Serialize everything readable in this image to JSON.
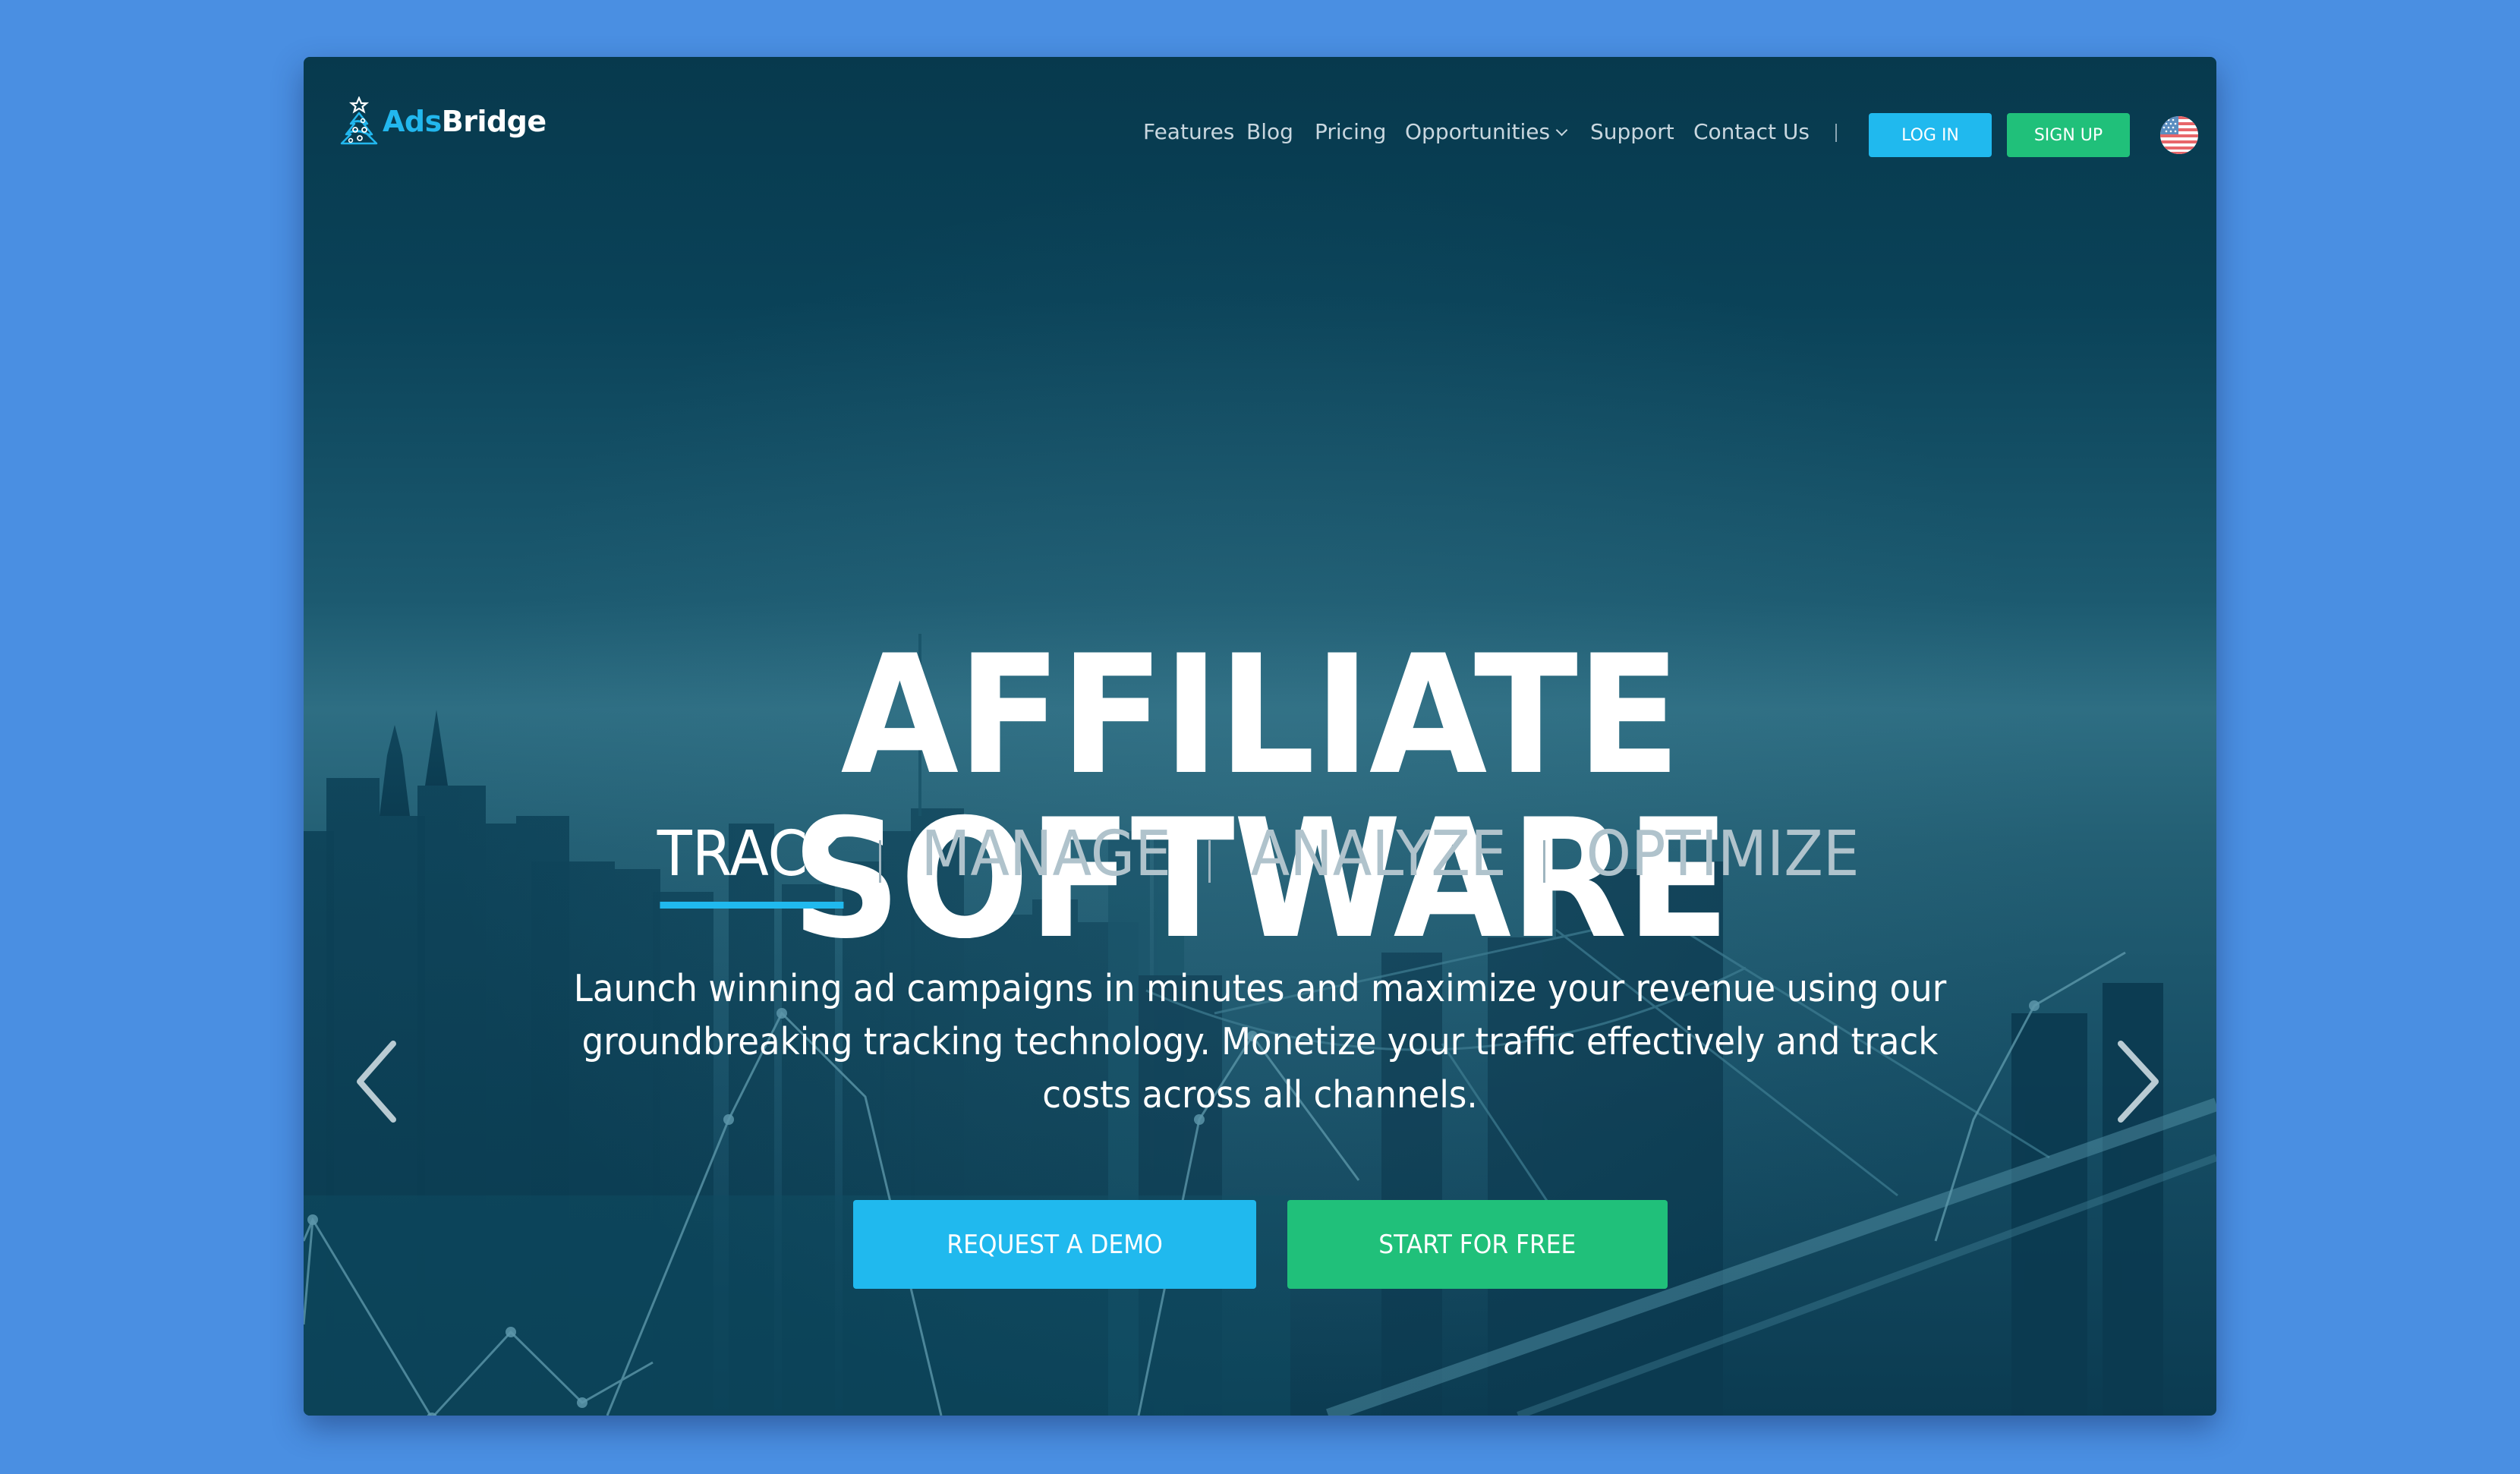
{
  "brand": {
    "name_part1": "Ads",
    "name_part2": "Bridge",
    "logo_icon": "christmas-tree-icon",
    "accent_color": "#20b9ee",
    "success_color": "#20c07a"
  },
  "nav": {
    "items": [
      {
        "label": "Features"
      },
      {
        "label": "Blog"
      },
      {
        "label": "Pricing"
      },
      {
        "label": "Opportunities",
        "has_dropdown": true
      },
      {
        "label": "Support"
      },
      {
        "label": "Contact Us"
      }
    ],
    "login_label": "LOG IN",
    "signup_label": "SIGN UP",
    "language_icon": "us-flag-icon"
  },
  "hero": {
    "title": "AFFILIATE SOFTWARE",
    "tabs": [
      {
        "label": "TRACK",
        "active": true
      },
      {
        "label": "MANAGE",
        "active": false
      },
      {
        "label": "ANALYZE",
        "active": false
      },
      {
        "label": "OPTIMIZE",
        "active": false
      }
    ],
    "description_lines": [
      "Launch winning ad campaigns in minutes and maximize your revenue using our",
      "groundbreaking tracking technology. Monetize your traffic effectively and track",
      "costs across all channels."
    ],
    "primary_cta": "REQUEST A DEMO",
    "secondary_cta": "START FOR FREE",
    "prev_icon": "chevron-left-icon",
    "next_icon": "chevron-right-icon"
  }
}
